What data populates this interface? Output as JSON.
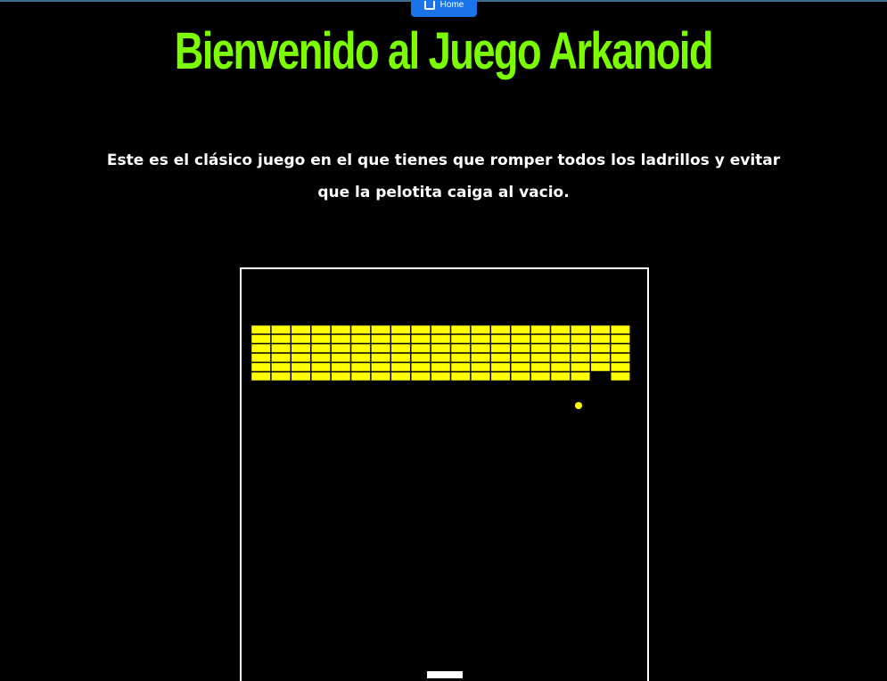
{
  "header": {
    "home_label": "Home"
  },
  "page": {
    "title": "Bienvenido al Juego Arkanoid",
    "intro": "Este es el clásico juego en el que tienes que romper todos los ladrillos y evitar que la pelotita caiga al vacio."
  },
  "game": {
    "brick_rows": 6,
    "brick_columns": 19,
    "broken_bricks": [
      [
        5,
        17
      ]
    ],
    "colors": {
      "brick": "#ffff00",
      "brick_border": "#000000",
      "ball": "#ffff00",
      "paddle": "#ffffff",
      "board_border": "#ffffff",
      "background": "#000000",
      "title": "#7cfc00"
    }
  }
}
